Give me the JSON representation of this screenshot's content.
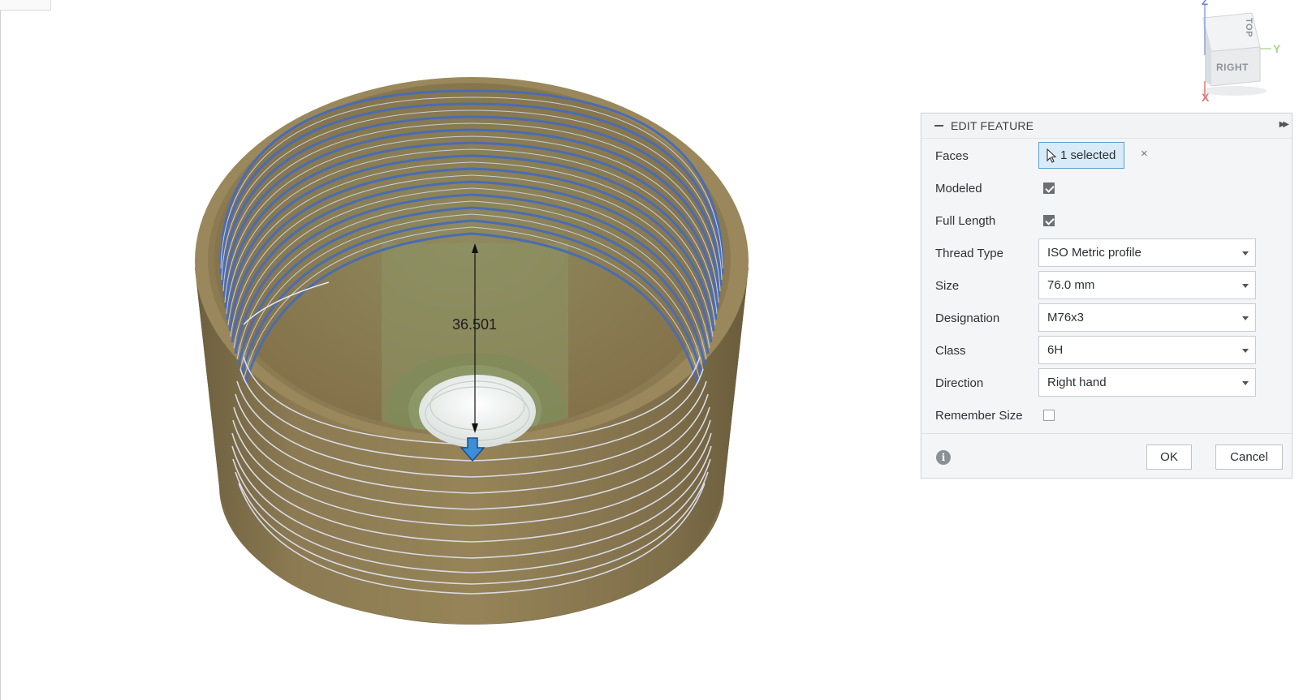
{
  "viewport": {
    "dimension_value": "36.501"
  },
  "viewcube": {
    "top_label": "TOP",
    "right_label": "RIGHT",
    "axis_x": "X",
    "axis_y": "Y",
    "axis_z": "Z"
  },
  "panel": {
    "title": "EDIT FEATURE",
    "faces": {
      "label": "Faces",
      "value": "1 selected",
      "clear": "×"
    },
    "modeled": {
      "label": "Modeled",
      "checked": true
    },
    "full_length": {
      "label": "Full Length",
      "checked": true
    },
    "thread_type": {
      "label": "Thread Type",
      "value": "ISO Metric profile"
    },
    "size": {
      "label": "Size",
      "value": "76.0 mm"
    },
    "designation": {
      "label": "Designation",
      "value": "M76x3"
    },
    "class": {
      "label": "Class",
      "value": "6H"
    },
    "direction": {
      "label": "Direction",
      "value": "Right hand"
    },
    "remember_size": {
      "label": "Remember Size",
      "checked": false
    },
    "ok_label": "OK",
    "cancel_label": "Cancel",
    "info_glyph": "i"
  },
  "colors": {
    "body": "#8a7a55",
    "thread": "#4a6cb3",
    "accent": "#2f80c9"
  }
}
